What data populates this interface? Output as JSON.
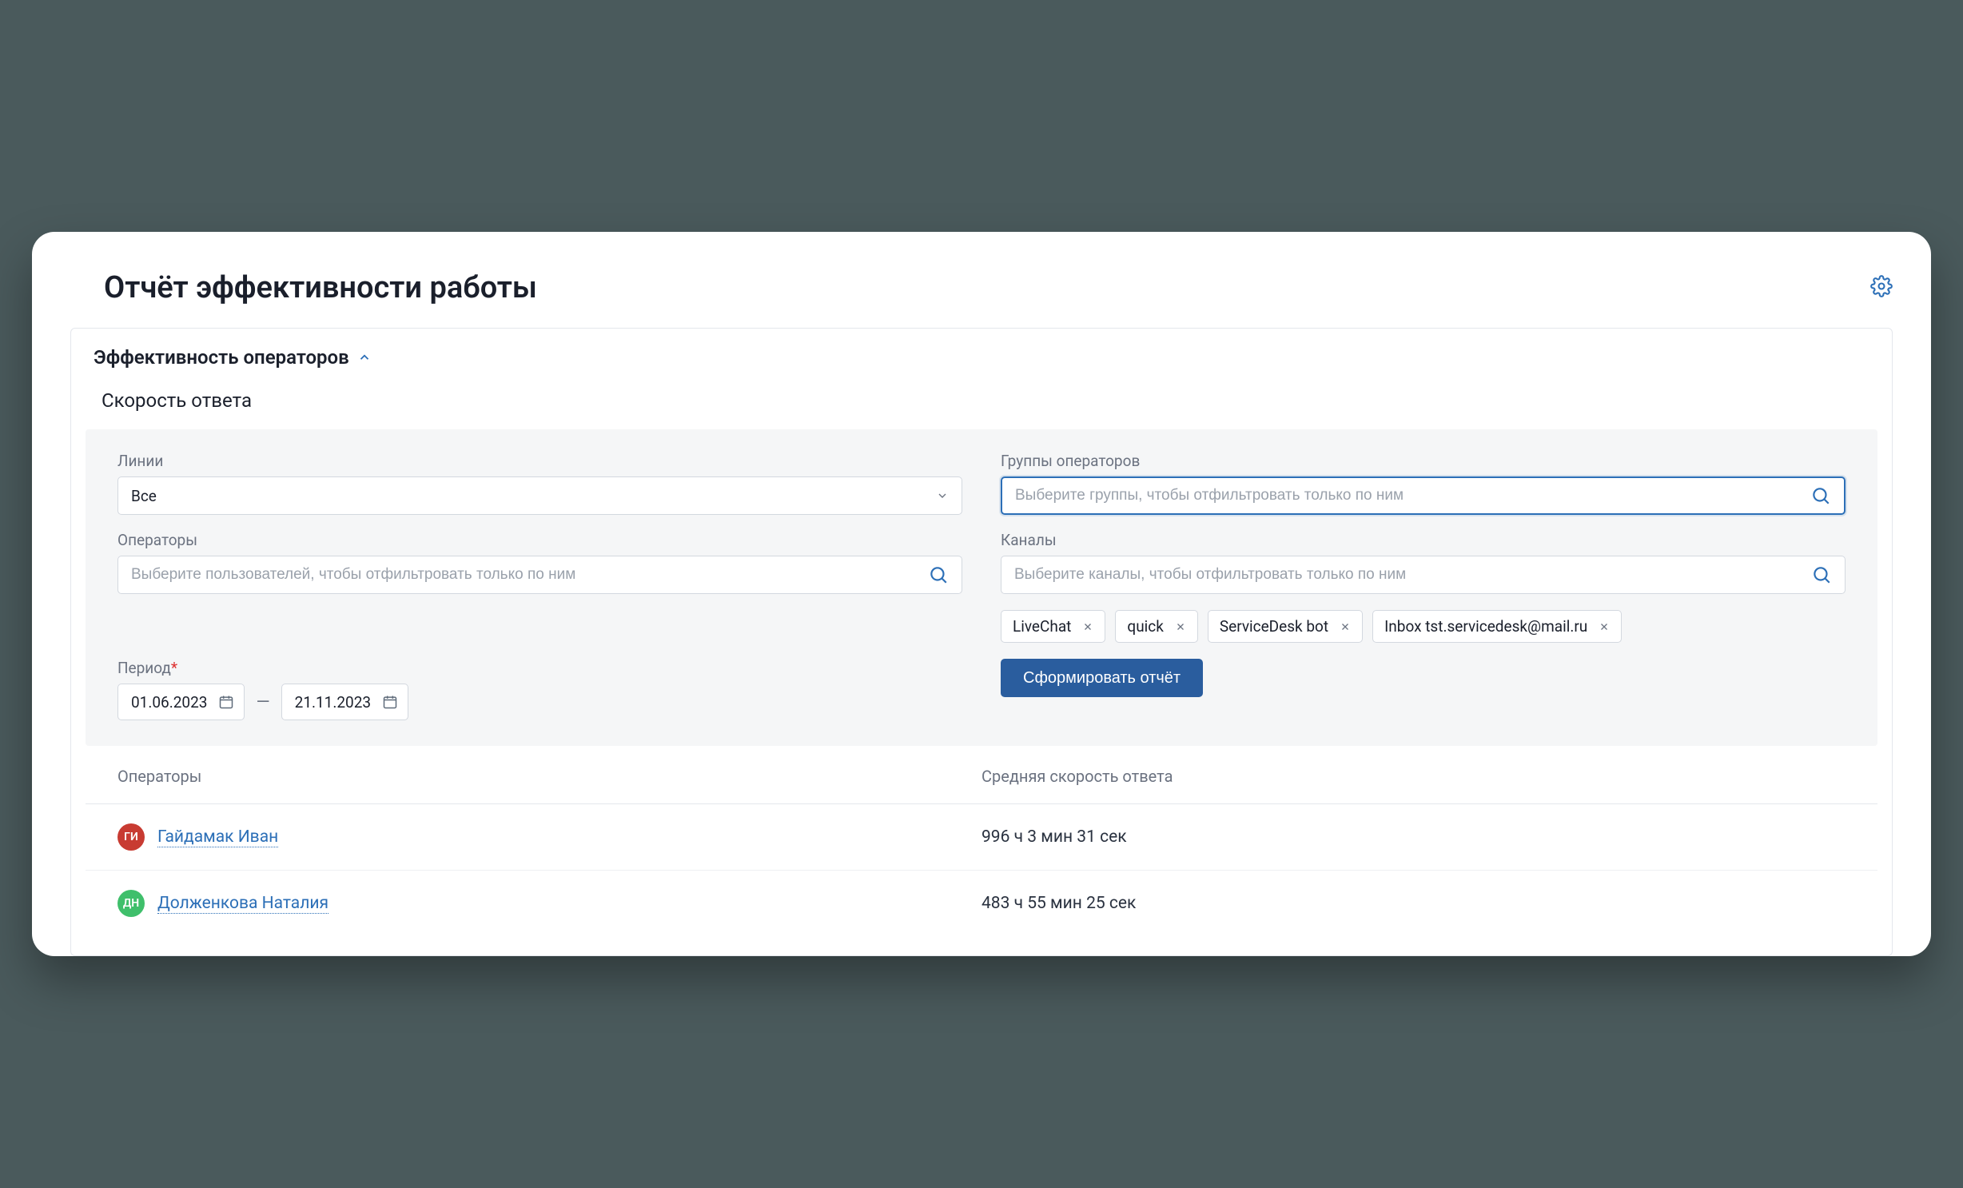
{
  "header": {
    "title": "Отчёт эффективности работы"
  },
  "panel": {
    "collapse_label": "Эффективность операторов",
    "subtitle": "Скорость ответа"
  },
  "filters": {
    "lines": {
      "label": "Линии",
      "value": "Все"
    },
    "groups": {
      "label": "Группы операторов",
      "placeholder": "Выберите группы, чтобы отфильтровать только по ним"
    },
    "operators": {
      "label": "Операторы",
      "placeholder": "Выберите пользователей, чтобы отфильтровать только по ним"
    },
    "channels": {
      "label": "Каналы",
      "placeholder": "Выберите каналы, чтобы отфильтровать только по ним",
      "chips": [
        "LiveChat",
        "quick",
        "ServiceDesk bot",
        "Inbox tst.servicedesk@mail.ru"
      ]
    },
    "period": {
      "label": "Период",
      "from": "01.06.2023",
      "to": "21.11.2023"
    },
    "submit_label": "Сформировать отчёт"
  },
  "table": {
    "columns": {
      "operator": "Операторы",
      "avg_response": "Средняя скорость ответа"
    },
    "rows": [
      {
        "initials": "ГИ",
        "avatar_color": "#c83b32",
        "name": "Гайдамак Иван",
        "value": "996 ч 3 мин 31 сек"
      },
      {
        "initials": "ДН",
        "avatar_color": "#3fbf6b",
        "name": "Долженкова Наталия",
        "value": "483 ч 55 мин 25 сек"
      }
    ]
  }
}
